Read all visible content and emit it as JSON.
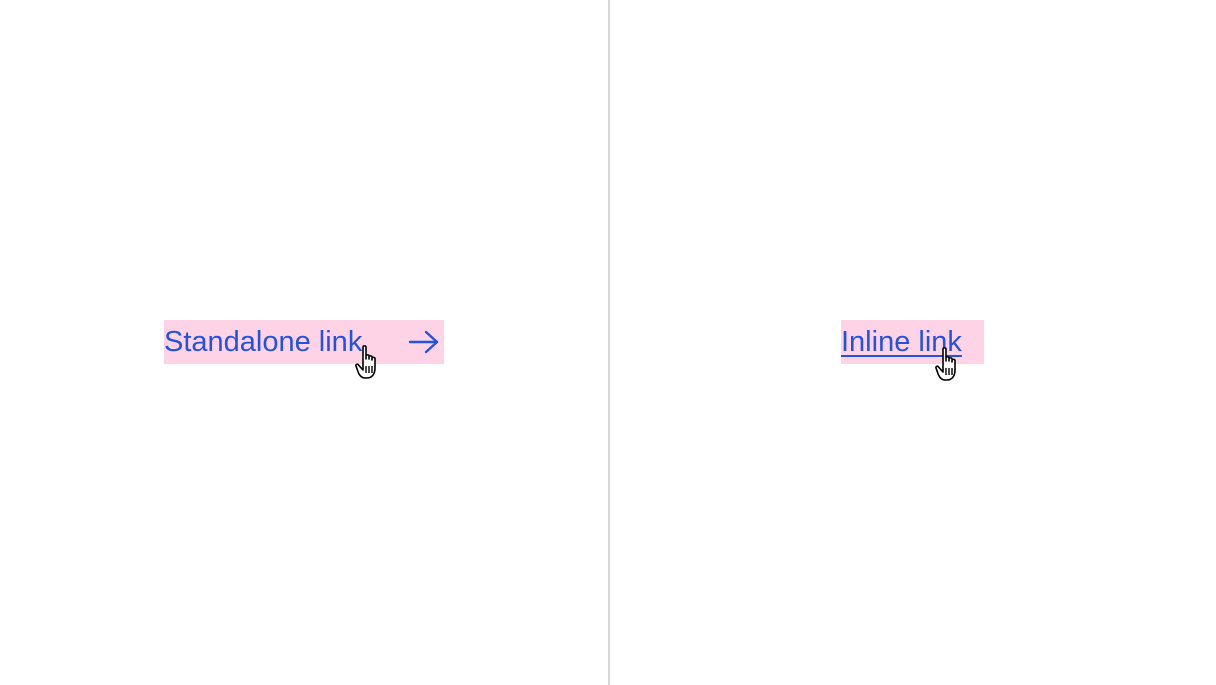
{
  "left_panel": {
    "standalone_link": {
      "label": "Standalone link",
      "icon": "arrow-right-icon",
      "cursor_icon": "pointer-hand-icon",
      "state": "hover"
    }
  },
  "right_panel": {
    "inline_link": {
      "label": "Inline link",
      "cursor_icon": "pointer-hand-icon",
      "state": "hover"
    }
  },
  "colors": {
    "link": "#2452e0",
    "highlight": "#ffd3e6",
    "divider": "#d6d6d6",
    "background": "#ffffff"
  }
}
